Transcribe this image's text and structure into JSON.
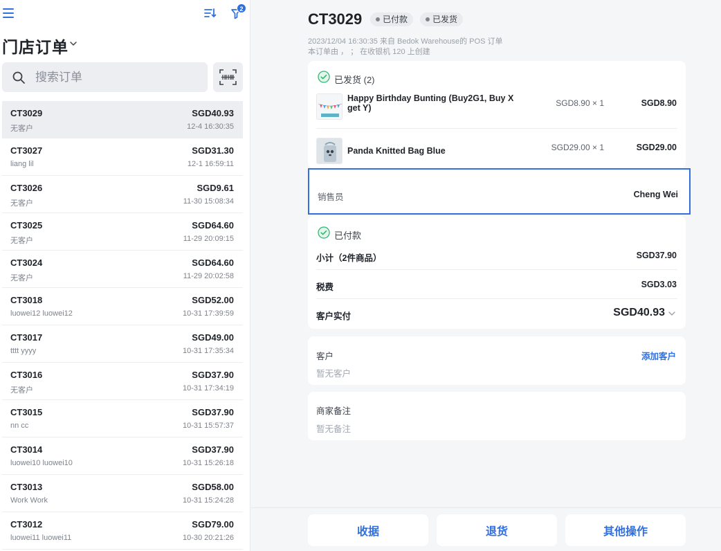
{
  "sidebar": {
    "title": "门店订单",
    "filter_count": "2",
    "search": {
      "placeholder": "搜索订单"
    },
    "orders": [
      {
        "id": "CT3029",
        "customer": "无客户",
        "amount": "SGD40.93",
        "time": "12-4 16:30:35",
        "selected": true
      },
      {
        "id": "CT3027",
        "customer": "liang lil",
        "amount": "SGD31.30",
        "time": "12-1 16:59:11"
      },
      {
        "id": "CT3026",
        "customer": "无客户",
        "amount": "SGD9.61",
        "time": "11-30 15:08:34"
      },
      {
        "id": "CT3025",
        "customer": "无客户",
        "amount": "SGD64.60",
        "time": "11-29 20:09:15"
      },
      {
        "id": "CT3024",
        "customer": "无客户",
        "amount": "SGD64.60",
        "time": "11-29 20:02:58"
      },
      {
        "id": "CT3018",
        "customer": "luowei12 luowei12",
        "amount": "SGD52.00",
        "time": "10-31 17:39:59"
      },
      {
        "id": "CT3017",
        "customer": "tttt yyyy",
        "amount": "SGD49.00",
        "time": "10-31 17:35:34"
      },
      {
        "id": "CT3016",
        "customer": "无客户",
        "amount": "SGD37.90",
        "time": "10-31 17:34:19"
      },
      {
        "id": "CT3015",
        "customer": "nn cc",
        "amount": "SGD37.90",
        "time": "10-31 15:57:37"
      },
      {
        "id": "CT3014",
        "customer": "luowei10 luowei10",
        "amount": "SGD37.90",
        "time": "10-31 15:26:18"
      },
      {
        "id": "CT3013",
        "customer": "Work Work",
        "amount": "SGD58.00",
        "time": "10-31 15:24:28"
      },
      {
        "id": "CT3012",
        "customer": "luowei11 luowei11",
        "amount": "SGD79.00",
        "time": "10-30 20:21:26"
      }
    ]
  },
  "detail": {
    "order_id": "CT3029",
    "status_paid": "已付款",
    "status_shipped": "已发货",
    "meta_line1": "2023/12/04 16:30:35 来自 Bedok Warehouse的 POS 订单",
    "meta_line2": "本订单由 ， ； 在收银机 120 上创建",
    "shipped_header": "已发货 (2)",
    "items": [
      {
        "name": "Happy Birthday Bunting (Buy2G1, Buy X get Y)",
        "unit": "SGD8.90 × 1",
        "total": "SGD8.90",
        "icon": "bunting-image"
      },
      {
        "name": "Panda Knitted Bag Blue",
        "unit": "SGD29.00 × 1",
        "total": "SGD29.00",
        "icon": "bag-image"
      }
    ],
    "salesperson_label": "销售员",
    "salesperson": "Cheng Wei",
    "paid_header": "已付款",
    "subtotal_label": "小计（2件商品）",
    "subtotal": "SGD37.90",
    "tax_label": "税费",
    "tax": "SGD3.03",
    "paid_label": "客户实付",
    "paid_total": "SGD40.93",
    "customer_label": "客户",
    "customer_empty": "暂无客户",
    "add_customer": "添加客户",
    "note_label": "商家备注",
    "note_empty": "暂无备注"
  },
  "actions": {
    "receipt": "收据",
    "refund": "退货",
    "more": "其他操作"
  },
  "colors": {
    "accent": "#2f6fe0",
    "success": "#2eb872",
    "highlight_border": "#2f6fe0"
  }
}
